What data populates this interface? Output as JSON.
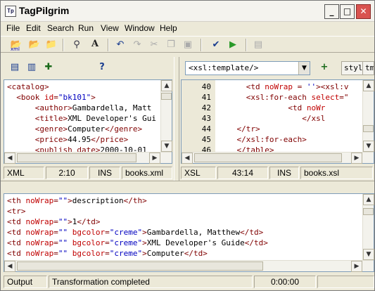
{
  "window": {
    "title": "TagPilgrim",
    "icon": "Tp",
    "min": "_",
    "max": "□",
    "close": "✕"
  },
  "menu": [
    "File",
    "Edit",
    "Search",
    "Run",
    "View",
    "Window",
    "Help"
  ],
  "toolbar": {
    "icons": [
      "new-xml-icon",
      "open-icon",
      "open-folder-icon",
      "find-icon",
      "font-icon",
      "undo-icon",
      "redo-icon",
      "cut-icon",
      "copy-icon",
      "paste-icon",
      "check-icon",
      "run-icon",
      "document-icon"
    ],
    "xml_label": "xml"
  },
  "left_pane": {
    "tool_icons": [
      "document-icon",
      "document-list-icon",
      "plus-icon",
      "help-icon"
    ],
    "lines": [
      [
        {
          "c": "tag",
          "t": "<catalog>"
        }
      ],
      [
        {
          "c": "txt",
          "t": "  "
        },
        {
          "c": "tag",
          "t": "<book "
        },
        {
          "c": "attr",
          "t": "id"
        },
        {
          "c": "tag",
          "t": "="
        },
        {
          "c": "val",
          "t": "\"bk101\""
        },
        {
          "c": "tag",
          "t": ">"
        }
      ],
      [
        {
          "c": "txt",
          "t": "      "
        },
        {
          "c": "tag",
          "t": "<author>"
        },
        {
          "c": "txt",
          "t": "Gambardella, Matt"
        }
      ],
      [
        {
          "c": "txt",
          "t": "      "
        },
        {
          "c": "tag",
          "t": "<title>"
        },
        {
          "c": "txt",
          "t": "XML Developer's Gui"
        }
      ],
      [
        {
          "c": "txt",
          "t": "      "
        },
        {
          "c": "tag",
          "t": "<genre>"
        },
        {
          "c": "txt",
          "t": "Computer"
        },
        {
          "c": "tag",
          "t": "</genre>"
        }
      ],
      [
        {
          "c": "txt",
          "t": "      "
        },
        {
          "c": "tag",
          "t": "<price>"
        },
        {
          "c": "txt",
          "t": "44.95"
        },
        {
          "c": "tag",
          "t": "</price>"
        }
      ],
      [
        {
          "c": "txt",
          "t": "      "
        },
        {
          "c": "tag",
          "t": "<publish_date>"
        },
        {
          "c": "txt",
          "t": "2000-10-01"
        }
      ]
    ],
    "status": {
      "type": "XML",
      "pos": "2:10",
      "mode": "INS",
      "file": "books.xml"
    }
  },
  "right_pane": {
    "combo_value": "<xsl:template/>",
    "btn_plus": "+",
    "btn_styl": "styl",
    "btn_tm": "tm",
    "line_numbers": [
      "40",
      "41",
      "42",
      "43",
      "44",
      "45",
      "46"
    ],
    "lines": [
      [
        {
          "c": "txt",
          "t": "      "
        },
        {
          "c": "tag",
          "t": "<td "
        },
        {
          "c": "attr",
          "t": "noWrap"
        },
        {
          "c": "tag",
          "t": " = "
        },
        {
          "c": "val",
          "t": "''"
        },
        {
          "c": "tag",
          "t": "><xsl:v"
        }
      ],
      [
        {
          "c": "txt",
          "t": "      "
        },
        {
          "c": "tag",
          "t": "<xsl:for-each "
        },
        {
          "c": "attr",
          "t": "select"
        },
        {
          "c": "tag",
          "t": "=\""
        }
      ],
      [
        {
          "c": "txt",
          "t": "               "
        },
        {
          "c": "tag",
          "t": "<td "
        },
        {
          "c": "attr",
          "t": "noWr"
        }
      ],
      [
        {
          "c": "txt",
          "t": "                  "
        },
        {
          "c": "tag",
          "t": "</xsl"
        }
      ],
      [
        {
          "c": "txt",
          "t": "    "
        },
        {
          "c": "tag",
          "t": "</tr>"
        }
      ],
      [
        {
          "c": "txt",
          "t": "    "
        },
        {
          "c": "tag",
          "t": "</xsl:for-each>"
        }
      ],
      [
        {
          "c": "txt",
          "t": "    "
        },
        {
          "c": "tag",
          "t": "</table>"
        }
      ]
    ],
    "status": {
      "type": "XSL",
      "pos": "43:14",
      "mode": "INS",
      "file": "books.xsl"
    }
  },
  "output_pane": {
    "lines": [
      [
        {
          "c": "tag",
          "t": "<th "
        },
        {
          "c": "attr",
          "t": "noWrap"
        },
        {
          "c": "tag",
          "t": "="
        },
        {
          "c": "val",
          "t": "\"\""
        },
        {
          "c": "tag",
          "t": ">"
        },
        {
          "c": "txt",
          "t": "description"
        },
        {
          "c": "tag",
          "t": "</th>"
        }
      ],
      [
        {
          "c": "tag",
          "t": "<tr>"
        }
      ],
      [
        {
          "c": "tag",
          "t": "<td "
        },
        {
          "c": "attr",
          "t": "noWrap"
        },
        {
          "c": "tag",
          "t": "="
        },
        {
          "c": "val",
          "t": "\"\""
        },
        {
          "c": "tag",
          "t": ">"
        },
        {
          "c": "txt",
          "t": "1"
        },
        {
          "c": "tag",
          "t": "</td>"
        }
      ],
      [
        {
          "c": "tag",
          "t": "<td "
        },
        {
          "c": "attr",
          "t": "noWrap"
        },
        {
          "c": "tag",
          "t": "="
        },
        {
          "c": "val",
          "t": "\"\" "
        },
        {
          "c": "attr",
          "t": "bgcolor"
        },
        {
          "c": "tag",
          "t": "="
        },
        {
          "c": "val",
          "t": "\"creme\""
        },
        {
          "c": "tag",
          "t": ">"
        },
        {
          "c": "txt",
          "t": "Gambardella, Matthew"
        },
        {
          "c": "tag",
          "t": "</td>"
        }
      ],
      [
        {
          "c": "tag",
          "t": "<td "
        },
        {
          "c": "attr",
          "t": "noWrap"
        },
        {
          "c": "tag",
          "t": "="
        },
        {
          "c": "val",
          "t": "\"\" "
        },
        {
          "c": "attr",
          "t": "bgcolor"
        },
        {
          "c": "tag",
          "t": "="
        },
        {
          "c": "val",
          "t": "\"creme\""
        },
        {
          "c": "tag",
          "t": ">"
        },
        {
          "c": "txt",
          "t": "XML Developer's Guide"
        },
        {
          "c": "tag",
          "t": "</td>"
        }
      ],
      [
        {
          "c": "tag",
          "t": "<td "
        },
        {
          "c": "attr",
          "t": "noWrap"
        },
        {
          "c": "tag",
          "t": "="
        },
        {
          "c": "val",
          "t": "\"\" "
        },
        {
          "c": "attr",
          "t": "bgcolor"
        },
        {
          "c": "tag",
          "t": "="
        },
        {
          "c": "val",
          "t": "\"creme\""
        },
        {
          "c": "tag",
          "t": ">"
        },
        {
          "c": "txt",
          "t": "Computer"
        },
        {
          "c": "tag",
          "t": "</td>"
        }
      ]
    ],
    "status": {
      "label": "Output",
      "message": "Transformation completed",
      "time": "0:00:00"
    }
  },
  "colors": {
    "tag": "#800000",
    "attr": "#c00000",
    "value": "#0000c0",
    "window_bg": "#ece9d8"
  }
}
